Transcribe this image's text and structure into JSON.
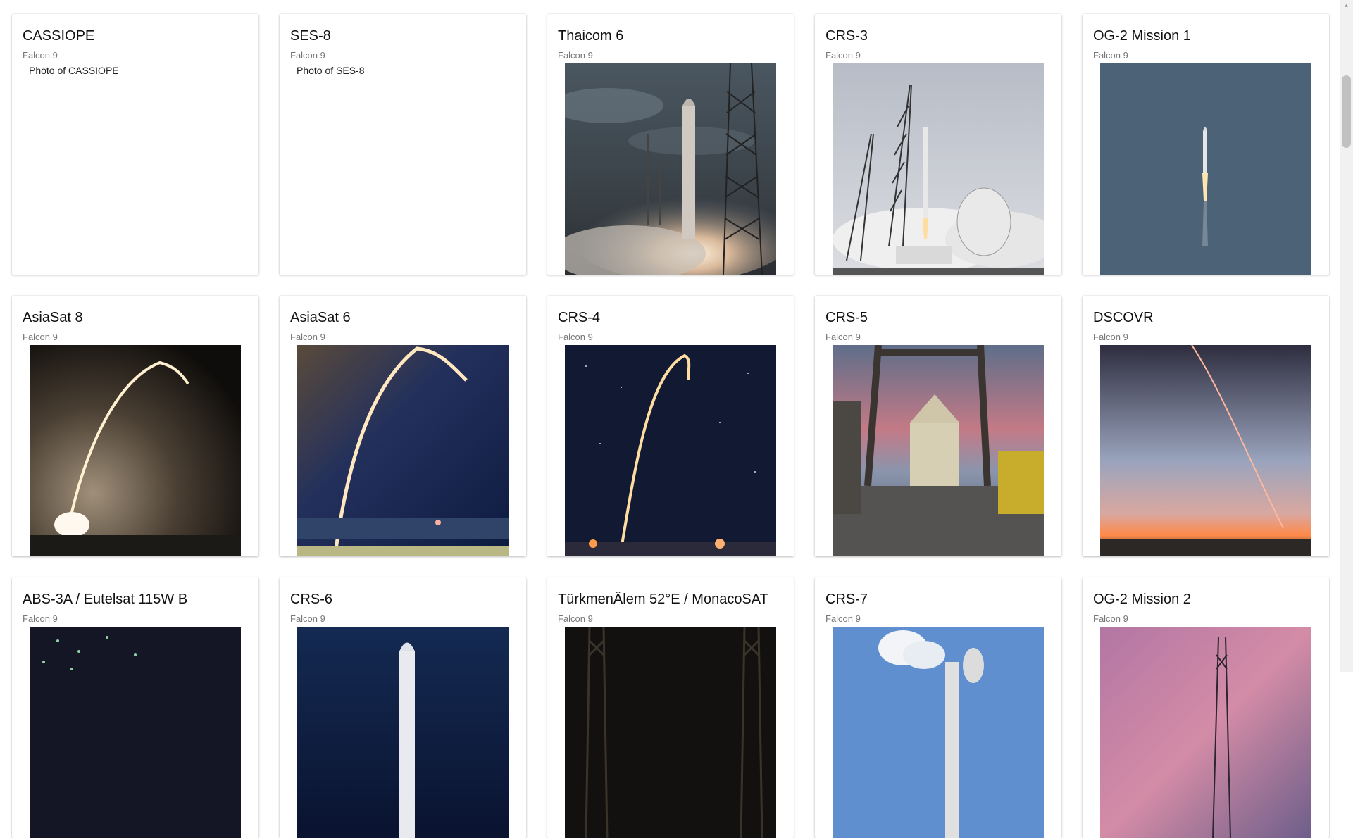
{
  "launches": [
    {
      "title": "CASSIOPE",
      "rocket": "Falcon 9",
      "alt": "Photo of CASSIOPE",
      "photo": "none"
    },
    {
      "title": "SES-8",
      "rocket": "Falcon 9",
      "alt": "Photo of SES-8",
      "photo": "none"
    },
    {
      "title": "Thaicom 6",
      "rocket": "Falcon 9",
      "photo": "pad-launch-cloudy"
    },
    {
      "title": "CRS-3",
      "rocket": "Falcon 9",
      "photo": "pad-launch-day"
    },
    {
      "title": "OG-2 Mission 1",
      "rocket": "Falcon 9",
      "photo": "rocket-in-sky"
    },
    {
      "title": "AsiaSat 8",
      "rocket": "Falcon 9",
      "photo": "night-arc-sepia"
    },
    {
      "title": "AsiaSat 6",
      "rocket": "Falcon 9",
      "photo": "night-arc-blue"
    },
    {
      "title": "CRS-4",
      "rocket": "Falcon 9",
      "photo": "night-arc-stars"
    },
    {
      "title": "CRS-5",
      "rocket": "Falcon 9",
      "photo": "dragon-recovery-ship"
    },
    {
      "title": "DSCOVR",
      "rocket": "Falcon 9",
      "photo": "dusk-trail"
    },
    {
      "title": "ABS-3A / Eutelsat 115W B",
      "rocket": "Falcon 9",
      "photo": "night-pad-lights"
    },
    {
      "title": "CRS-6",
      "rocket": "Falcon 9",
      "photo": "night-rocket-blue"
    },
    {
      "title": "TürkmenÄlem 52°E / MonacoSAT",
      "rocket": "Falcon 9",
      "photo": "dark-towers"
    },
    {
      "title": "CRS-7",
      "rocket": "Falcon 9",
      "photo": "day-pad-clouds"
    },
    {
      "title": "OG-2 Mission 2",
      "rocket": "Falcon 9",
      "photo": "sunset-tower"
    }
  ]
}
